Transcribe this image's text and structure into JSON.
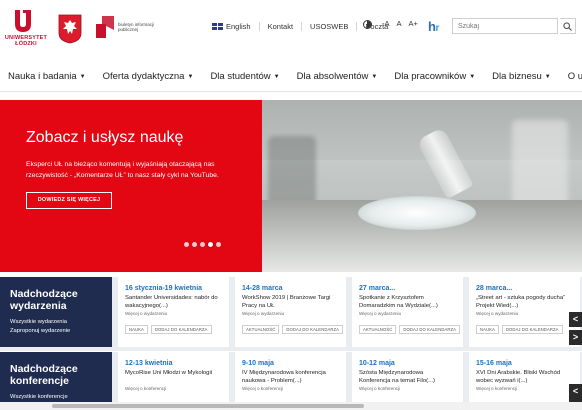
{
  "header": {
    "university_name": "UNIWERSYTET ŁÓDZKI",
    "bip_text": "biuletyn informacji publicznej",
    "links": [
      "English",
      "Kontakt",
      "USOSWEB",
      "Poczta"
    ],
    "font_sizes": [
      "-A",
      "A",
      "A+"
    ],
    "search_placeholder": "Szukaj"
  },
  "nav": {
    "items": [
      "Nauka i badania",
      "Oferta dydaktyczna",
      "Dla studentów",
      "Dla absolwentów",
      "Dla pracowników",
      "Dla biznesu",
      "O uczelni"
    ]
  },
  "hero": {
    "title": "Zobacz i usłysz naukę",
    "text": "Eksperci UŁ na bieżąco komentują i wyjaśniają otaczającą nas rzeczywistość - „Komentarze UŁ” to nasz stały cykl na YouTube.",
    "button": "DOWIEDZ SIĘ WIĘCEJ",
    "slides": 5,
    "active_slide": 3
  },
  "events": {
    "title": "Nadchodzące wydarzenia",
    "links": [
      "Wszystkie wydarzenia",
      "Zaproponuj wydarzenie"
    ],
    "cards": [
      {
        "date": "16 stycznia-19 kwietnia",
        "title": "Santander Universidades: nabór do wakacyjnego(...)",
        "more": "Więcej o wydarzeniu",
        "tags": [
          "NAUKA",
          "DODAJ DO KALENDARZA"
        ]
      },
      {
        "date": "14-28 marca",
        "title": "WorkShow 2019 | Branżowe Targi Pracy na UŁ",
        "more": "Więcej o wydarzeniu",
        "tags": [
          "AKTUALNOŚĆ",
          "DODAJ DO KALENDARZA"
        ]
      },
      {
        "date": "27 marca...",
        "title": "Spotkanie z Krzysztofem Domaradzkim na Wydziale(...)",
        "more": "Więcej o wydarzeniu",
        "tags": [
          "AKTUALNOŚĆ",
          "DODAJ DO KALENDARZA"
        ]
      },
      {
        "date": "28 marca...",
        "title": "„Street art - sztuka pogody ducha” Projekt Wied(...)",
        "more": "Więcej o wydarzeniu",
        "tags": [
          "NAUKA",
          "DODAJ DO KALENDARZA"
        ]
      }
    ]
  },
  "conferences": {
    "title": "Nadchodzące konferencje",
    "links": [
      "Wszystkie konferencje"
    ],
    "cards": [
      {
        "date": "12-13 kwietnia",
        "title": "MycoRise Uni Młodzi w Mykologii",
        "more": "Więcej o konferencji"
      },
      {
        "date": "9-10 maja",
        "title": "IV Międzynarodowa konferencja naukowa - Problem(...)",
        "more": "Więcej o konferencji"
      },
      {
        "date": "10-12 maja",
        "title": "Szósta Międzynarodowa Konferencja na temat Filo(...)",
        "more": "Więcej o konferencji"
      },
      {
        "date": "15-16 maja",
        "title": "XVI Dni Arabskie. Bliski Wschód wobec wyzwań i(...)",
        "more": "Więcej o konferencji"
      }
    ]
  },
  "arrows": {
    "prev": "<",
    "next": ">"
  },
  "colors": {
    "brand_red": "#e30613",
    "navy": "#1f2c4f",
    "date_blue": "#1f6fbf"
  }
}
